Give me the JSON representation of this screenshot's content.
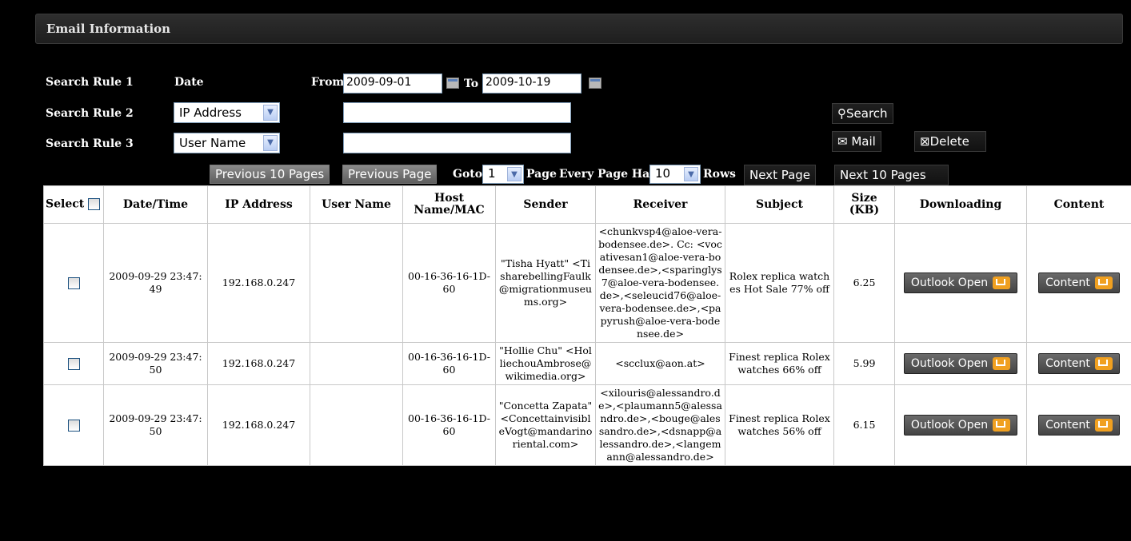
{
  "panel": {
    "title": "Email Information"
  },
  "rules": {
    "rule1": {
      "label": "Search Rule 1",
      "field": "Date",
      "from_label": "From",
      "from_value": "2009-09-01",
      "to_label": "To",
      "to_value": "2009-10-19"
    },
    "rule2": {
      "label": "Search Rule 2",
      "select": "IP Address",
      "value": ""
    },
    "rule3": {
      "label": "Search Rule 3",
      "select": "User Name",
      "value": ""
    }
  },
  "actions": {
    "search": "Search",
    "mail": "Mail",
    "delete": "Delete"
  },
  "pager": {
    "prev10": "Previous 10 Pages",
    "prev": "Previous Page",
    "goto": "Goto",
    "page_value": "1",
    "page": "Page",
    "every": "Every Page Has",
    "rows_value": "10",
    "rows": "Rows",
    "next": "Next Page",
    "next10": "Next 10 Pages"
  },
  "table": {
    "headers": {
      "select": "Select",
      "datetime": "Date/Time",
      "ip": "IP Address",
      "user": "User Name",
      "host": "Host Name/MAC",
      "sender": "Sender",
      "receiver": "Receiver",
      "subject": "Subject",
      "size": "Size (KB)",
      "downloading": "Downloading",
      "content": "Content"
    },
    "rows": [
      {
        "datetime": "2009-09-29 23:47:49",
        "ip": "192.168.0.247",
        "user": "",
        "host": "00-16-36-16-1D-60",
        "sender": "\"Tisha Hyatt\" <TisharebellingFaulk@migrationmuseums.org>",
        "receiver": "<chunkvsp4@aloe-vera-bodensee.de>. Cc: <vocativesan1@aloe-vera-bodensee.de>,<sparinglys7@aloe-vera-bodensee.de>,<seleucid76@aloe-vera-bodensee.de>,<papyrush@aloe-vera-bodensee.de>",
        "subject": "Rolex replica watches Hot Sale 77% off",
        "size": "6.25",
        "download_btn": "Outlook Open",
        "content_btn": "Content"
      },
      {
        "datetime": "2009-09-29 23:47:50",
        "ip": "192.168.0.247",
        "user": "",
        "host": "00-16-36-16-1D-60",
        "sender": "\"Hollie Chu\" <HolliechouAmbrose@wikimedia.org>",
        "receiver": "<scclux@aon.at>",
        "subject": "Finest replica Rolex watches 66% off",
        "size": "5.99",
        "download_btn": "Outlook Open",
        "content_btn": "Content"
      },
      {
        "datetime": "2009-09-29 23:47:50",
        "ip": "192.168.0.247",
        "user": "",
        "host": "00-16-36-16-1D-60",
        "sender": "\"Concetta Zapata\" <ConcettainvisibleVogt@mandarinoriental.com>",
        "receiver": "<xilouris@alessandro.de>,<plaumann5@alessandro.de>,<bouge@alessandro.de>,<dsnapp@alessandro.de>,<langemann@alessandro.de>",
        "subject": "Finest replica Rolex watches 56% off",
        "size": "6.15",
        "download_btn": "Outlook Open",
        "content_btn": "Content"
      }
    ]
  }
}
